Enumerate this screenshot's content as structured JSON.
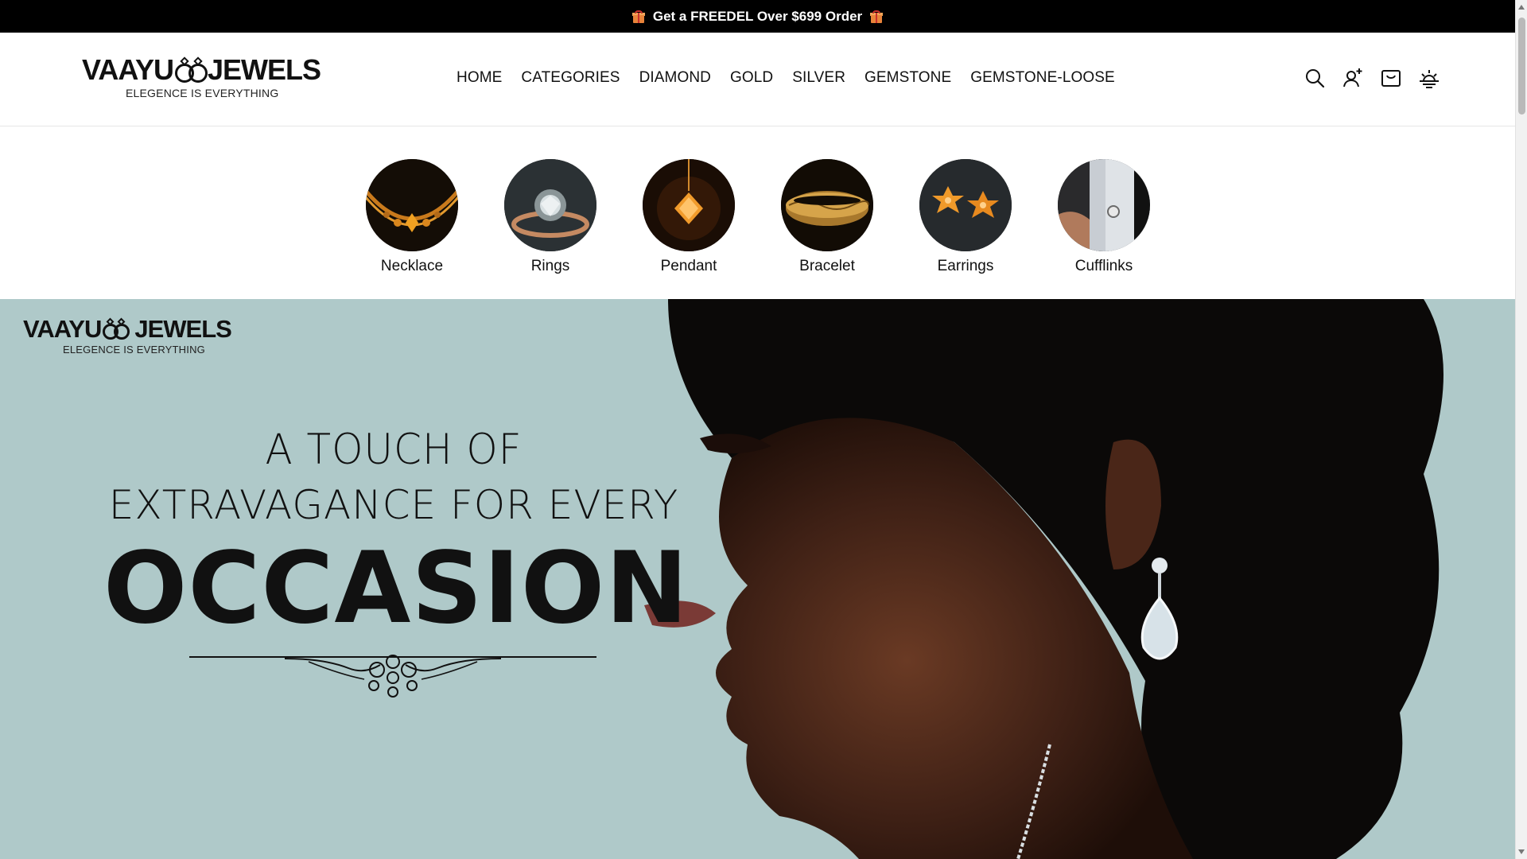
{
  "announcement": {
    "prefix_icon": "gift-icon",
    "text": "Get a FREEDEL Over $699 Order",
    "suffix_icon": "gift-icon"
  },
  "brand": {
    "name_left": "VAAYU",
    "name_right": "JEWELS",
    "tagline": "ELEGENCE IS EVERYTHING"
  },
  "nav": {
    "items": [
      "HOME",
      "CATEGORIES",
      "DIAMOND",
      "GOLD",
      "SILVER",
      "GEMSTONE",
      "GEMSTONE-LOOSE"
    ]
  },
  "header_icons": [
    "search-icon",
    "account-add-icon",
    "cart-icon",
    "theme-toggle-icon"
  ],
  "categories": [
    {
      "label": "Necklace",
      "image": "necklace-image"
    },
    {
      "label": "Rings",
      "image": "ring-image"
    },
    {
      "label": "Pendant",
      "image": "pendant-image"
    },
    {
      "label": "Bracelet",
      "image": "bracelet-image"
    },
    {
      "label": "Earrings",
      "image": "earrings-image"
    },
    {
      "label": "Cufflinks",
      "image": "cufflinks-image"
    }
  ],
  "hero": {
    "line1": "A TOUCH OF",
    "line2": "EXTRAVAGANCE FOR EVERY",
    "headline": "OCCASION",
    "background": "#afc9c9",
    "image": "woman-profile-with-diamond-earring"
  }
}
